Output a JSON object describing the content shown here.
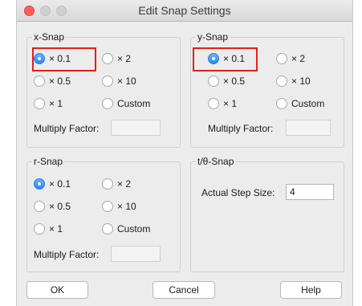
{
  "window": {
    "title": "Edit Snap Settings"
  },
  "x_snap": {
    "legend": "x-Snap",
    "options": [
      "× 0.1",
      "× 2",
      "× 0.5",
      "× 10",
      "× 1",
      "Custom"
    ],
    "selected": "× 0.1",
    "factor_label": "Multiply Factor:",
    "factor_value": ""
  },
  "y_snap": {
    "legend": "y-Snap",
    "options": [
      "× 0.1",
      "× 2",
      "× 0.5",
      "× 10",
      "× 1",
      "Custom"
    ],
    "selected": "× 0.1",
    "factor_label": "Multiply Factor:",
    "factor_value": ""
  },
  "r_snap": {
    "legend": "r-Snap",
    "options": [
      "× 0.1",
      "× 2",
      "× 0.5",
      "× 10",
      "× 1",
      "Custom"
    ],
    "selected": "× 0.1",
    "factor_label": "Multiply Factor:",
    "factor_value": ""
  },
  "t_snap": {
    "legend": "t/θ-Snap",
    "step_label": "Actual Step Size:",
    "step_value": "4"
  },
  "buttons": {
    "ok": "OK",
    "cancel": "Cancel",
    "help": "Help"
  },
  "colors": {
    "highlight": "#e0201c",
    "radio_selected": "#2f88f0"
  }
}
